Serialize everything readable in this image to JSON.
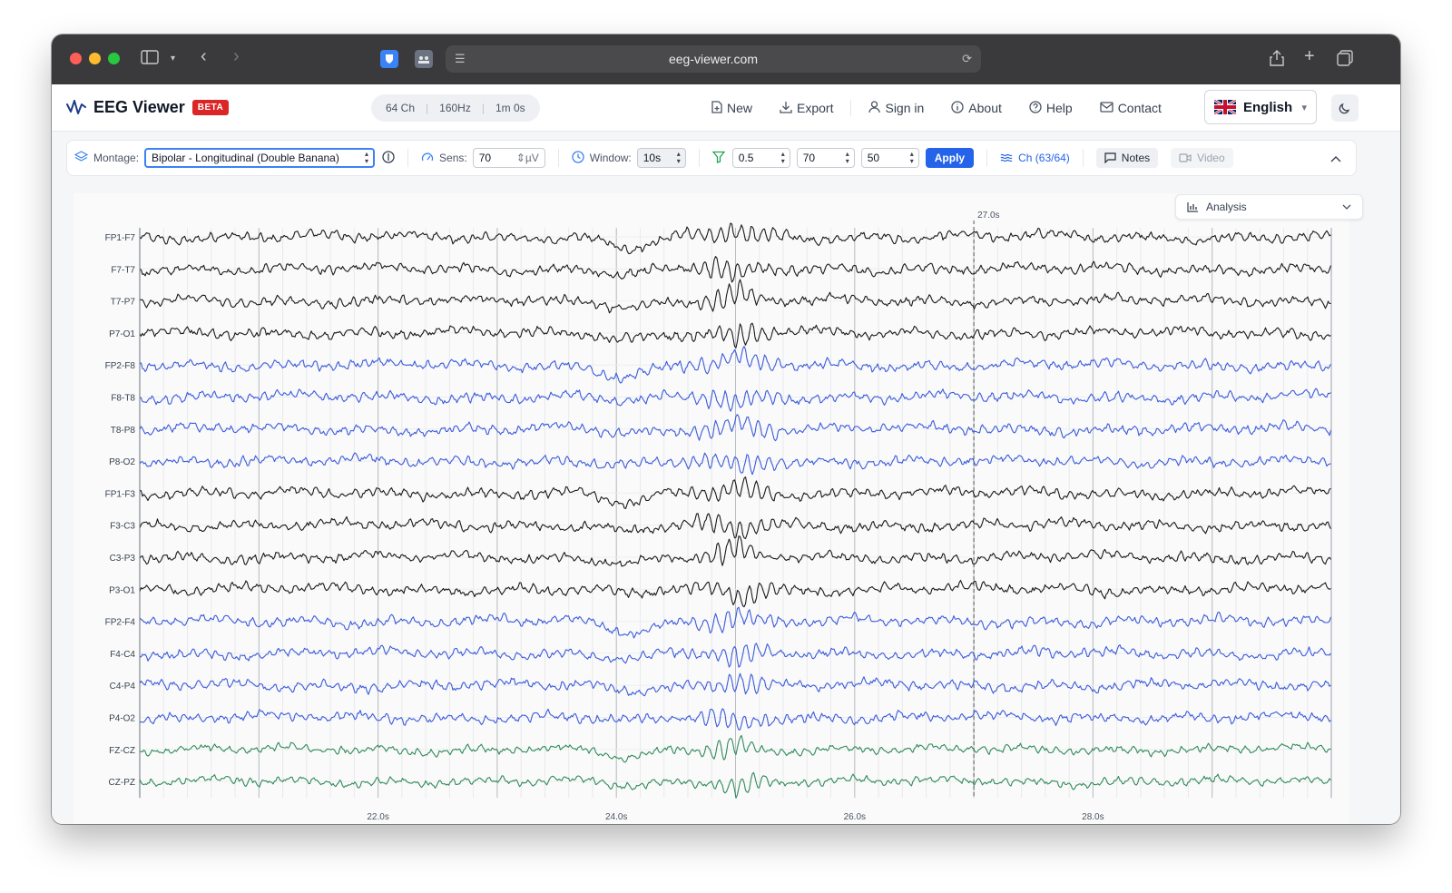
{
  "browser": {
    "url": "eeg-viewer.com"
  },
  "app": {
    "title": "EEG Viewer",
    "badge": "BETA",
    "stats": [
      "64 Ch",
      "160Hz",
      "1m 0s"
    ]
  },
  "nav": {
    "new": "New",
    "export": "Export",
    "signin": "Sign in",
    "about": "About",
    "help": "Help",
    "contact": "Contact",
    "language": "English"
  },
  "controls": {
    "montage_label": "Montage:",
    "montage_value": "Bipolar - Longitudinal (Double Banana)",
    "sens_label": "Sens:",
    "sens_value": "70",
    "sens_unit": "µV",
    "window_label": "Window:",
    "window_value": "10s",
    "filter_low": "0.5",
    "filter_high": "70",
    "filter_notch": "50",
    "apply": "Apply",
    "channels": "Ch (63/64)",
    "notes": "Notes",
    "video": "Video"
  },
  "analysis": {
    "label": "Analysis"
  },
  "colors": {
    "accent": "#2563eb",
    "beta": "#dc2626",
    "trace_black": "#1a1a1a",
    "trace_blue": "#3b5bdb",
    "trace_green": "#2f8a5a"
  },
  "chart_data": {
    "type": "line",
    "x_start": 20.0,
    "x_end": 30.0,
    "x_ticks": [
      {
        "value": 22.0,
        "label": "22.0s"
      },
      {
        "value": 24.0,
        "label": "24.0s"
      },
      {
        "value": 26.0,
        "label": "26.0s"
      },
      {
        "value": 28.0,
        "label": "28.0s"
      }
    ],
    "cursor": {
      "value": 27.0,
      "label": "27.0s"
    },
    "event_center": 25.0,
    "channels": [
      {
        "name": "FP1-F7",
        "group": "black"
      },
      {
        "name": "F7-T7",
        "group": "black"
      },
      {
        "name": "T7-P7",
        "group": "black"
      },
      {
        "name": "P7-O1",
        "group": "black"
      },
      {
        "name": "FP2-F8",
        "group": "blue"
      },
      {
        "name": "F8-T8",
        "group": "blue"
      },
      {
        "name": "T8-P8",
        "group": "blue"
      },
      {
        "name": "P8-O2",
        "group": "blue"
      },
      {
        "name": "FP1-F3",
        "group": "black"
      },
      {
        "name": "F3-C3",
        "group": "black"
      },
      {
        "name": "C3-P3",
        "group": "black"
      },
      {
        "name": "P3-O1",
        "group": "black"
      },
      {
        "name": "FP2-F4",
        "group": "blue"
      },
      {
        "name": "F4-C4",
        "group": "blue"
      },
      {
        "name": "C4-P4",
        "group": "blue"
      },
      {
        "name": "P4-O2",
        "group": "blue"
      },
      {
        "name": "FZ-CZ",
        "group": "green"
      },
      {
        "name": "CZ-PZ",
        "group": "green"
      }
    ]
  }
}
